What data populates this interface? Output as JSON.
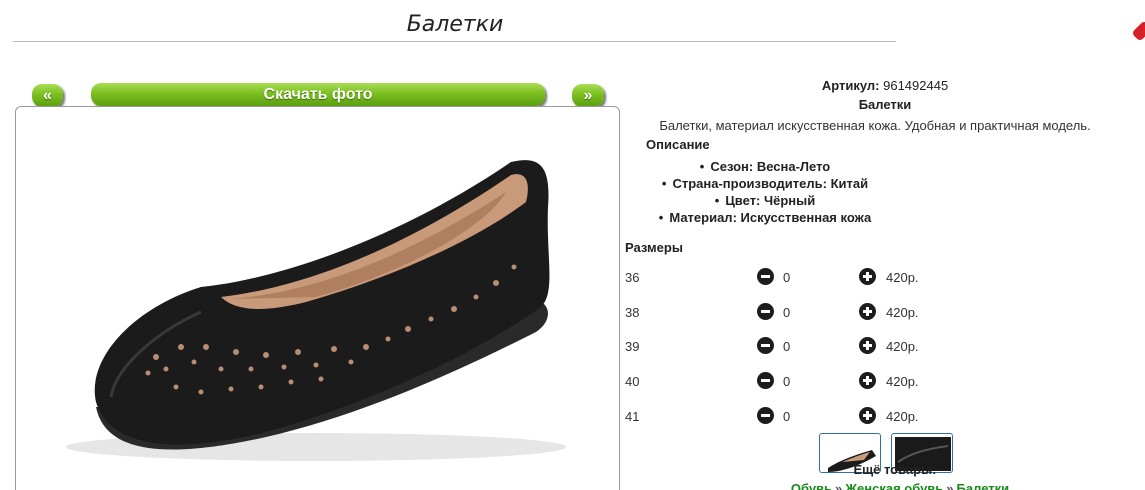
{
  "page": {
    "title": "Балетки"
  },
  "gallery": {
    "prev_label": "«",
    "download_label": "Скачать фото",
    "next_label": "»"
  },
  "product": {
    "article_label": "Артикул:",
    "article_value": "961492445",
    "name": "Балетки",
    "description": "Балетки, материал искусственная кожа. Удобная и практичная модель.",
    "description_heading": "Описание",
    "features": [
      "Сезон: Весна-Лето",
      "Страна-производитель: Китай",
      "Цвет: Чёрный",
      "Материал: Искусственная кожа"
    ]
  },
  "sizes": {
    "heading": "Размеры",
    "rows": [
      {
        "size": "36",
        "qty": "0",
        "price": "420р."
      },
      {
        "size": "38",
        "qty": "0",
        "price": "420р."
      },
      {
        "size": "39",
        "qty": "0",
        "price": "420р."
      },
      {
        "size": "40",
        "qty": "0",
        "price": "420р."
      },
      {
        "size": "41",
        "qty": "0",
        "price": "420р."
      }
    ]
  },
  "more": {
    "heading": "Ещё товары:",
    "breadcrumb": [
      "Обувь",
      "Женская обувь",
      "Балетки"
    ],
    "separator": "»"
  },
  "colors": {
    "accent_green": "#7cbf20",
    "link_green": "#1a8a1a",
    "thumb_border": "#2f6fa8"
  }
}
